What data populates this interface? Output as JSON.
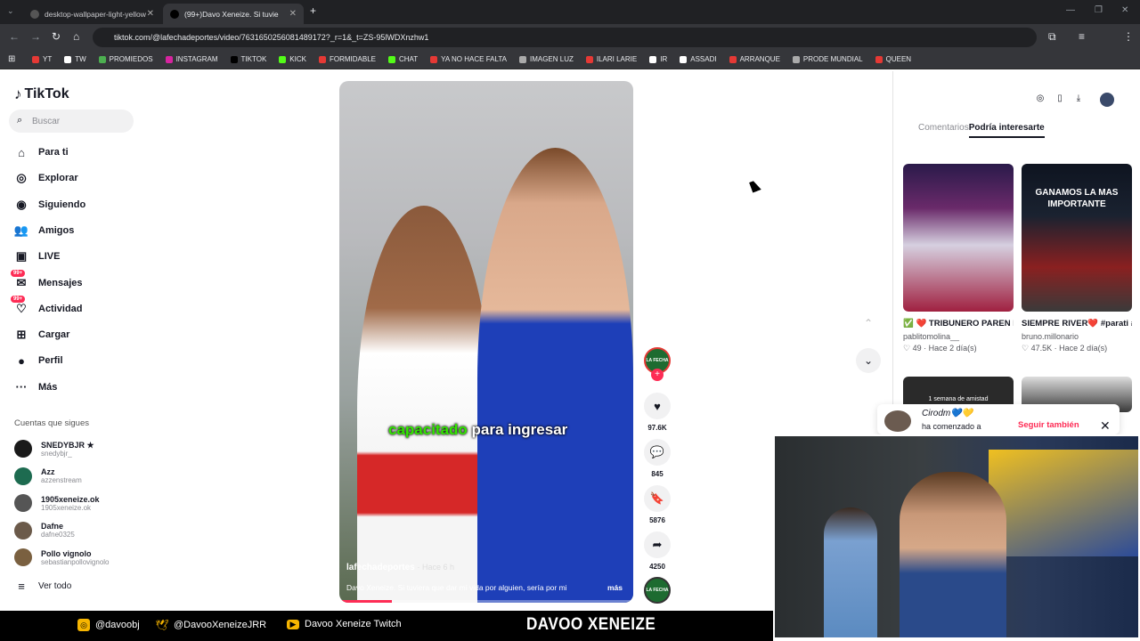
{
  "browser": {
    "tabs": [
      {
        "title": "desktop-wallpaper-light-yellow",
        "active": false
      },
      {
        "title": "(99+)Davo Xeneize. Si tuvie",
        "active": true
      }
    ],
    "url": "tiktok.com/@lafechadeportes/video/7631650256081489172?_r=1&_t=ZS-95lWDXnzhw1",
    "bookmarks": [
      "YT",
      "TW",
      "PROMIEDOS",
      "INSTAGRAM",
      "TIKTOK",
      "KICK",
      "FORMIDABLE",
      "CHAT",
      "YA NO HACE FALTA",
      "IMAGEN LUZ",
      "ILARI LARIE",
      "IR",
      "ASSADI",
      "ARRANQUE",
      "PRODE MUNDIAL",
      "QUEEN"
    ]
  },
  "sidebar": {
    "logo": "TikTok",
    "search_placeholder": "Buscar",
    "nav": [
      {
        "label": "Para ti",
        "icon": "home-icon"
      },
      {
        "label": "Explorar",
        "icon": "compass-icon"
      },
      {
        "label": "Siguiendo",
        "icon": "following-icon"
      },
      {
        "label": "Amigos",
        "icon": "friends-icon"
      },
      {
        "label": "LIVE",
        "icon": "live-icon"
      },
      {
        "label": "Mensajes",
        "icon": "messages-icon",
        "badge": "99+"
      },
      {
        "label": "Actividad",
        "icon": "activity-icon",
        "badge": "99+"
      },
      {
        "label": "Cargar",
        "icon": "upload-icon"
      },
      {
        "label": "Perfil",
        "icon": "profile-icon"
      },
      {
        "label": "Más",
        "icon": "more-icon"
      }
    ],
    "following_title": "Cuentas que sigues",
    "following": [
      {
        "name": "SNEDYBJR ★",
        "user": "snedybjr_"
      },
      {
        "name": "Azz",
        "user": "azzenstream"
      },
      {
        "name": "1905xeneize.ok",
        "user": "1905xeneize.ok"
      },
      {
        "name": "Dafne",
        "user": "dafne0325"
      },
      {
        "name": "Pollo vignolo",
        "user": "sebastianpollovignolo"
      }
    ],
    "see_all": "Ver todo"
  },
  "video": {
    "caption_highlight": "capacitado",
    "caption_rest": "para ingresar",
    "author": "lafechadeportes",
    "time": "· Hace 6 h",
    "description": "Davo Xeneize. Si tuviera que dar mi vida por alguien, sería por mi",
    "more": "más",
    "progress": 0.18
  },
  "actions": {
    "avatar_label": "LA FECHA",
    "likes": "97.6K",
    "comments": "845",
    "saves": "5876",
    "shares": "4250"
  },
  "right_panel": {
    "tab_comments": "Comentarios",
    "tab_interest": "Podría interesarte",
    "cards": [
      {
        "title": "✅ ❤️ TRIBUNERO PAREN LA MANO...",
        "author": "pablitomolina__",
        "likes": "49",
        "time": "Hace 2 día(s)"
      },
      {
        "title": "SIEMPRE RIVER❤️ #parati #fyp...",
        "author": "bruno.millonario",
        "likes": "47.5K",
        "time": "Hace 2 día(s)",
        "overlay": "GANAMOS LA MAS IMPORTANTE"
      }
    ],
    "card3_overlay": "1 semana de amistad"
  },
  "toast": {
    "name": "Cirodm💙💛",
    "text": "ha comenzado a",
    "action": "Seguir también"
  },
  "stream_bar": {
    "instagram": "@davoobj",
    "twitter": "@DavooXeneizeJRR",
    "youtube": "Davoo Xeneize Twitch",
    "brand": "DAVOO XENEIZE"
  },
  "colors": {
    "accent": "#fe2c55",
    "highlight": "#32e600"
  }
}
